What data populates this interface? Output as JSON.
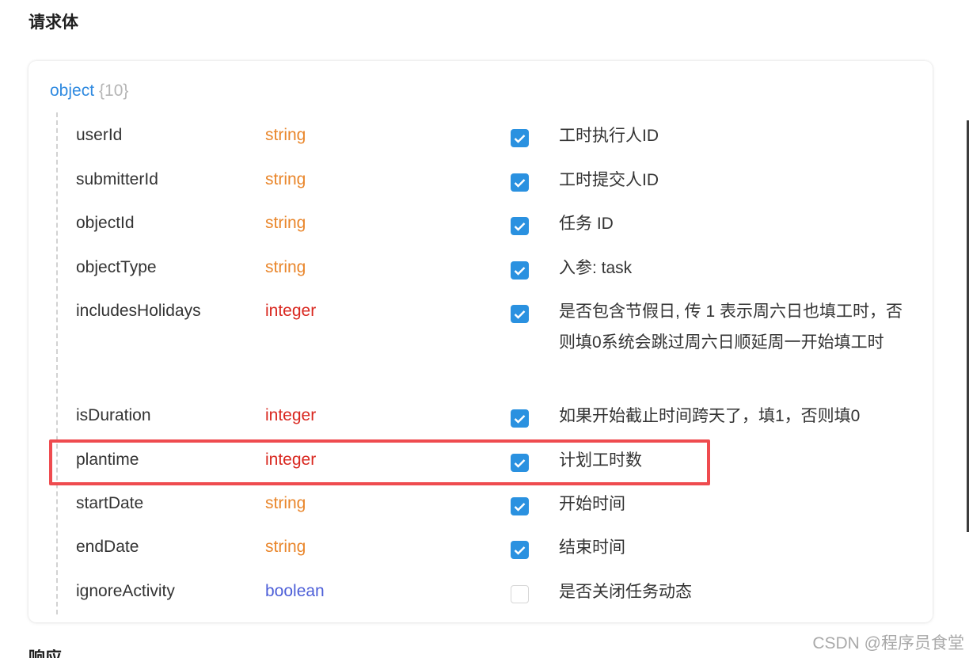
{
  "section": {
    "title": "请求体",
    "next_title_partial": "响应"
  },
  "object": {
    "type": "object",
    "count": "{10}"
  },
  "fields": [
    {
      "name": "userId",
      "type": "string",
      "required": true,
      "desc": "工时执行人ID"
    },
    {
      "name": "submitterId",
      "type": "string",
      "required": true,
      "desc": "工时提交人ID"
    },
    {
      "name": "objectId",
      "type": "string",
      "required": true,
      "desc": "任务 ID"
    },
    {
      "name": "objectType",
      "type": "string",
      "required": true,
      "desc": "入参: task"
    },
    {
      "name": "includesHolidays",
      "type": "integer",
      "required": true,
      "desc": "是否包含节假日, 传 1 表示周六日也填工时，否则填0系统会跳过周六日顺延周一开始填工时"
    },
    {
      "name": "isDuration",
      "type": "integer",
      "required": true,
      "desc": "如果开始截止时间跨天了，填1，否则填0"
    },
    {
      "name": "plantime",
      "type": "integer",
      "required": true,
      "desc": "计划工时数"
    },
    {
      "name": "startDate",
      "type": "string",
      "required": true,
      "desc": "开始时间"
    },
    {
      "name": "endDate",
      "type": "string",
      "required": true,
      "desc": "结束时间"
    },
    {
      "name": "ignoreActivity",
      "type": "boolean",
      "required": false,
      "desc": "是否关闭任务动态"
    }
  ],
  "watermark": "CSDN @程序员食堂",
  "colors": {
    "string": "#e9862b",
    "integer": "#d9271f",
    "boolean": "#4d5fd8",
    "object": "#2f8ae0",
    "checkbox": "#2a91e0",
    "highlight": "#ef4b4f"
  }
}
